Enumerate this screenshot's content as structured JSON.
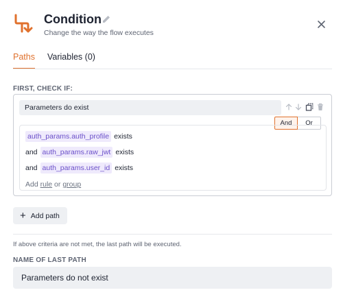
{
  "header": {
    "title": "Condition",
    "subtitle": "Change the way the flow executes"
  },
  "tabs": [
    {
      "label": "Paths",
      "active": true
    },
    {
      "label": "Variables (0)",
      "active": false
    }
  ],
  "first_check_label": "FIRST, CHECK IF:",
  "path": {
    "name": "Parameters do exist",
    "logic": {
      "and_label": "And",
      "or_label": "Or",
      "selected": "And"
    },
    "rules": [
      {
        "prefix": "",
        "field": "auth_params.auth_profile",
        "operator": "exists"
      },
      {
        "prefix": "and",
        "field": "auth_params.raw_jwt",
        "operator": "exists"
      },
      {
        "prefix": "and",
        "field": "auth_params.user_id",
        "operator": "exists"
      }
    ],
    "add_links": {
      "add": "Add",
      "rule": "rule",
      "or": "or",
      "group": "group"
    }
  },
  "add_path_label": "Add path",
  "info_text": "If above criteria are not met, the last path will be executed.",
  "last_path": {
    "label": "NAME OF LAST PATH",
    "value": "Parameters do not exist"
  },
  "colors": {
    "accent": "#e0712d",
    "chip_bg": "#efeafc",
    "chip_text": "#6a4fc9"
  }
}
